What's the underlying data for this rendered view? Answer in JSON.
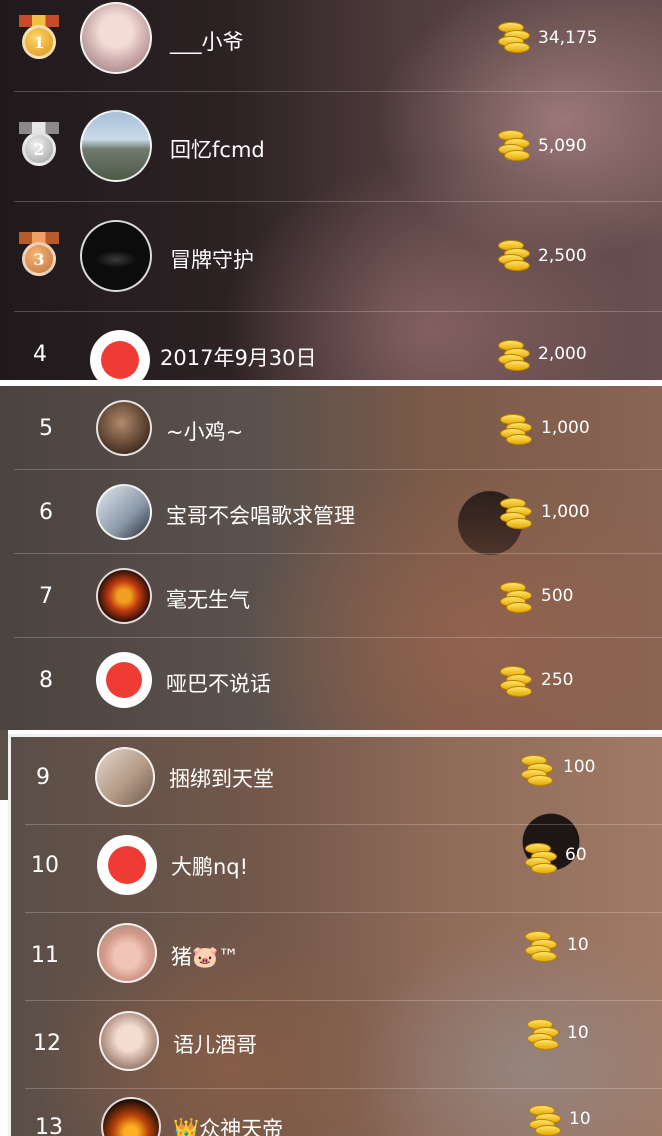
{
  "colors": {
    "gold": "#e0a21a",
    "silver": "#c9c9c9",
    "bronze": "#d98a4a",
    "coin": "#f2c52a",
    "logo_red": "#ee3b34"
  },
  "icons": {
    "medal": "medal-icon",
    "coin": "coin-stack-icon"
  },
  "leaderboard": [
    {
      "rank": "1",
      "name": "___小爷",
      "amount": "34,175"
    },
    {
      "rank": "2",
      "name": "回忆fcmd",
      "amount": "5,090"
    },
    {
      "rank": "3",
      "name": "冒牌守护",
      "amount": "2,500"
    },
    {
      "rank": "4",
      "name": "2017年9月30日",
      "amount": "2,000"
    },
    {
      "rank": "5",
      "name": "~小鸡~",
      "amount": "1,000"
    },
    {
      "rank": "6",
      "name": "宝哥不会唱歌求管理",
      "amount": "1,000"
    },
    {
      "rank": "7",
      "name": "毫无生气",
      "amount": "500"
    },
    {
      "rank": "8",
      "name": "哑巴不说话",
      "amount": "250"
    },
    {
      "rank": "9",
      "name": "捆绑到天堂",
      "amount": "100"
    },
    {
      "rank": "10",
      "name": "大鹏nq!",
      "amount": "60"
    },
    {
      "rank": "11",
      "name": "猪🐷™",
      "amount": "10"
    },
    {
      "rank": "12",
      "name": "语儿酒哥",
      "amount": "10"
    },
    {
      "rank": "13",
      "name": "👑众神天帝",
      "amount": "10"
    }
  ]
}
